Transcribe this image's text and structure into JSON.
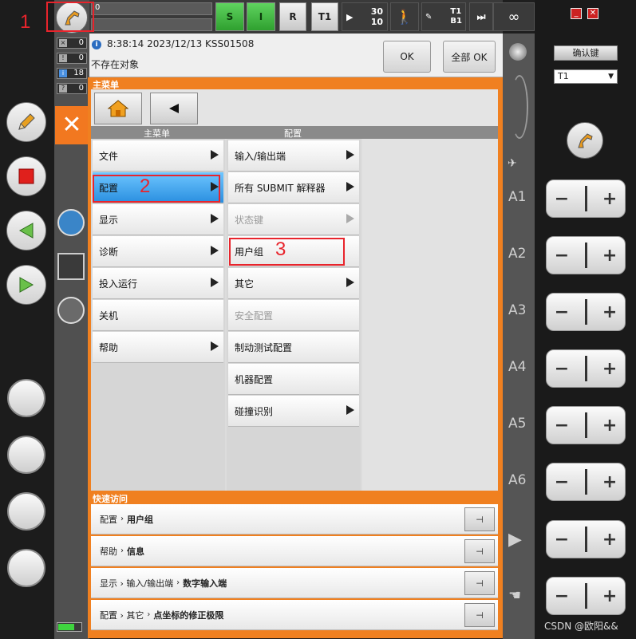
{
  "annotations": {
    "n1": "1",
    "n2": "2",
    "n3": "3"
  },
  "status_counts": [
    "0",
    "0",
    "18",
    "0"
  ],
  "topbar": {
    "s": "S",
    "i": "I",
    "r": "R",
    "t1": "T1",
    "speed_top": "30",
    "speed_bottom": "10",
    "tool_top": "T1",
    "tool_bottom": "B1",
    "infinity": "∞",
    "progress": "0"
  },
  "message": {
    "time": "8:38:14 2023/12/13 KSS01508",
    "text": "不存在对象",
    "ok": "OK",
    "all_ok": "全部 OK"
  },
  "main_menu": {
    "title": "主菜单",
    "col1_head": "主菜单",
    "col2_head": "配置"
  },
  "col1": [
    {
      "label": "文件",
      "arrow": true
    },
    {
      "label": "配置",
      "arrow": true
    },
    {
      "label": "显示",
      "arrow": true
    },
    {
      "label": "诊断",
      "arrow": true
    },
    {
      "label": "投入运行",
      "arrow": true
    },
    {
      "label": "关机",
      "arrow": false
    },
    {
      "label": "帮助",
      "arrow": true
    }
  ],
  "col2": [
    {
      "label": "输入/输出端",
      "arrow": true
    },
    {
      "label": "所有 SUBMIT 解释器",
      "arrow": true
    },
    {
      "label": "状态键",
      "arrow": true,
      "disabled": true
    },
    {
      "label": "用户组",
      "arrow": false
    },
    {
      "label": "其它",
      "arrow": true
    },
    {
      "label": "安全配置",
      "arrow": false,
      "disabled": true
    },
    {
      "label": "制动测试配置",
      "arrow": false
    },
    {
      "label": "机器配置",
      "arrow": false
    },
    {
      "label": "碰撞识别",
      "arrow": true
    }
  ],
  "quick_access": {
    "title": "快速访问",
    "rows": [
      {
        "path": "配置",
        "leaf": "用户组"
      },
      {
        "path": "帮助",
        "leaf": "信息"
      },
      {
        "path": "显示 › 输入/输出端",
        "leaf": "数字输入端"
      },
      {
        "path": "配置 › 其它",
        "leaf": "点坐标的修正极限"
      }
    ]
  },
  "right": {
    "confirm": "确认键",
    "mode_select": "T1",
    "axes": [
      "A1",
      "A2",
      "A3",
      "A4",
      "A5",
      "A6"
    ]
  },
  "watermark": "CSDN @欧阳&&"
}
